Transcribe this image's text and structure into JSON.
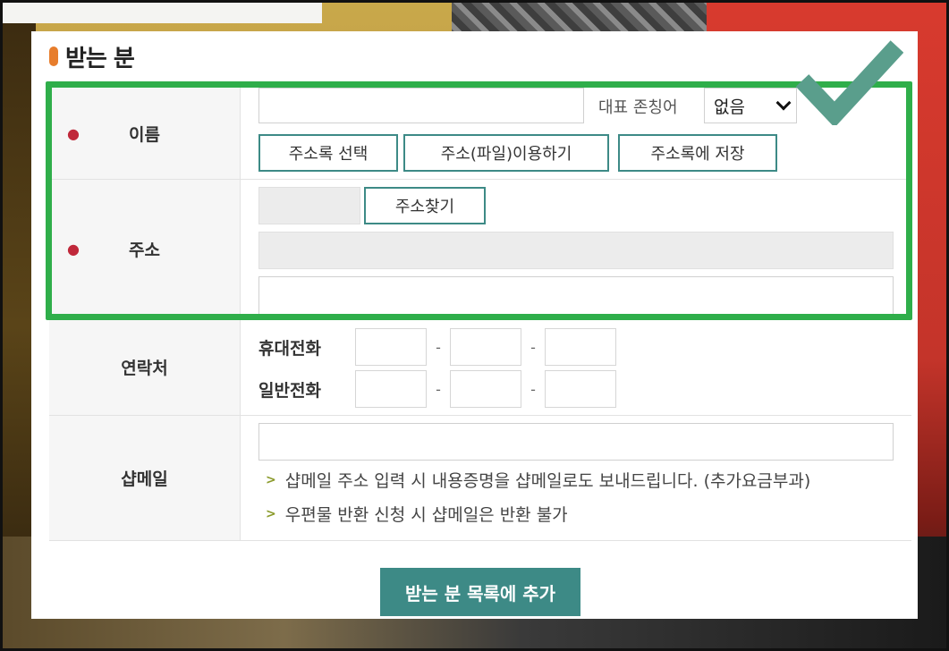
{
  "section": {
    "title": "받는 분"
  },
  "name_row": {
    "label": "이름",
    "honorific_label": "대표 존칭어",
    "honorific_value": "없음",
    "buttons": [
      "주소록 선택",
      "주소(파일)이용하기",
      "주소록에 저장"
    ]
  },
  "address_row": {
    "label": "주소",
    "find_button": "주소찾기"
  },
  "contact_row": {
    "label": "연락처",
    "mobile_label": "휴대전화",
    "phone_label": "일반전화",
    "separator": "-"
  },
  "email_row": {
    "label": "샵메일",
    "notes": [
      "샵메일 주소 입력 시 내용증명을 샵메일로도 보내드립니다. (추가요금부과)",
      "우편물 반환 신청 시 샵메일은 반환 불가"
    ]
  },
  "submit_label": "받는 분 목록에 추가",
  "colors": {
    "accent": "#3d8a86",
    "highlight": "#2fae4a",
    "check": "#5a9e8c",
    "required": "#c0283a",
    "title_marker": "#e77d2c"
  },
  "icons": {
    "required": "required-dot-icon",
    "check": "checkmark-icon",
    "note": "chevron-right-icon",
    "select": "chevron-down-icon"
  }
}
